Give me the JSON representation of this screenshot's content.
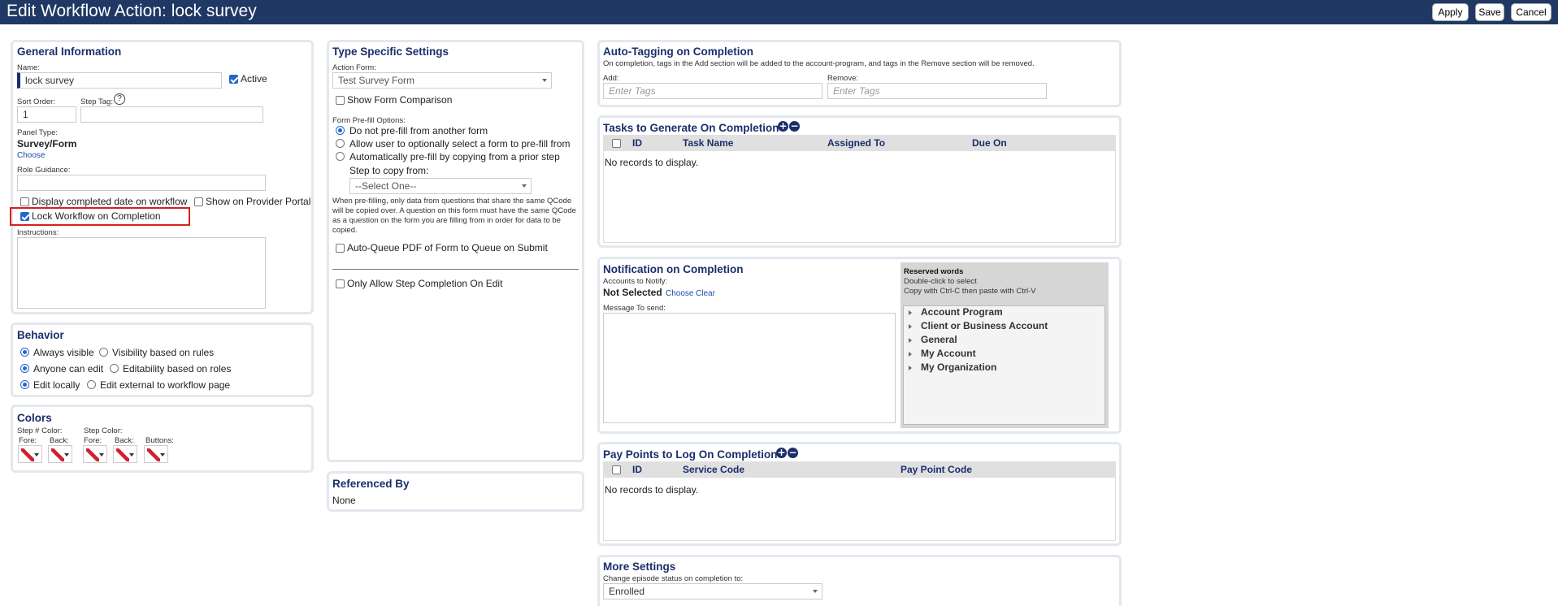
{
  "header": {
    "title": "Edit Workflow Action: lock survey",
    "apply_label": "Apply",
    "save_label": "Save",
    "cancel_label": "Cancel"
  },
  "general": {
    "title": "General Information",
    "name_label": "Name:",
    "name_value": "lock survey",
    "active_label": "Active",
    "active_checked": true,
    "sort_order_label": "Sort Order:",
    "sort_order_value": "1",
    "step_tag_label": "Step Tag:",
    "step_tag_value": "",
    "panel_type_label": "Panel Type:",
    "panel_type_value": "Survey/Form",
    "choose_label": "Choose",
    "role_guidance_label": "Role Guidance:",
    "display_completed_label": "Display completed date on workflow",
    "show_provider_label": "Show on Provider Portal",
    "lock_workflow_label": "Lock Workflow on Completion",
    "instructions_label": "Instructions:"
  },
  "behavior": {
    "title": "Behavior",
    "always_visible": "Always visible",
    "visibility_rules": "Visibility based on rules",
    "anyone_edit": "Anyone can edit",
    "editability_roles": "Editability based on roles",
    "edit_locally": "Edit locally",
    "edit_external": "Edit external to workflow page"
  },
  "colors": {
    "title": "Colors",
    "step_num_color": "Step # Color:",
    "step_color": "Step Color:",
    "fore": "Fore:",
    "back": "Back:",
    "buttons": "Buttons:"
  },
  "type_specific": {
    "title": "Type Specific Settings",
    "action_form_label": "Action Form:",
    "action_form_value": "Test Survey Form",
    "show_form_comparison": "Show Form Comparison",
    "prefill_options_label": "Form Pre-fill Options:",
    "prefill_opt1": "Do not pre-fill from another form",
    "prefill_opt2": "Allow user to optionally select a form to pre-fill from",
    "prefill_opt3": "Automatically pre-fill by copying from a prior step",
    "step_to_copy_label": "Step to copy from:",
    "step_to_copy_value": "--Select One--",
    "prefill_note_1": "When pre-filling, only data from questions that share the same QCode",
    "prefill_note_2": "will be copied over. A question on this form must have the same QCode",
    "prefill_note_3": "as a question on the form you are filling from in order for data to be",
    "prefill_note_4": "copied.",
    "auto_queue_label": "Auto-Queue PDF of Form to Queue on Submit",
    "only_allow_label": "Only Allow Step Completion On Edit"
  },
  "referenced_by": {
    "title": "Referenced By",
    "value": "None"
  },
  "auto_tagging": {
    "title": "Auto-Tagging on Completion",
    "description": "On completion, tags in the Add section will be added to the account-program, and tags in the Remove section will be removed.",
    "add_label": "Add:",
    "add_placeholder": "Enter Tags",
    "remove_label": "Remove:",
    "remove_placeholder": "Enter Tags"
  },
  "tasks": {
    "title": "Tasks to Generate On Completion",
    "columns": [
      "ID",
      "Task Name",
      "Assigned To",
      "Due On"
    ],
    "empty": "No records to display."
  },
  "notification": {
    "title": "Notification on Completion",
    "accounts_label": "Accounts to Notify:",
    "accounts_value": "Not Selected",
    "choose_label": "Choose",
    "clear_label": "Clear",
    "message_label": "Message To send:",
    "reserved_title": "Reserved words",
    "reserved_hint1": "Double-click to select",
    "reserved_hint2": "Copy with Ctrl-C then paste with Ctrl-V",
    "tree_items": [
      "Account Program",
      "Client or Business Account",
      "General",
      "My Account",
      "My Organization"
    ]
  },
  "pay_points": {
    "title": "Pay Points to Log On Completion",
    "columns": [
      "ID",
      "Service Code",
      "Pay Point Code"
    ],
    "empty": "No records to display."
  },
  "more_settings": {
    "title": "More Settings",
    "episode_label": "Change episode status on completion to:",
    "episode_value": "Enrolled"
  }
}
